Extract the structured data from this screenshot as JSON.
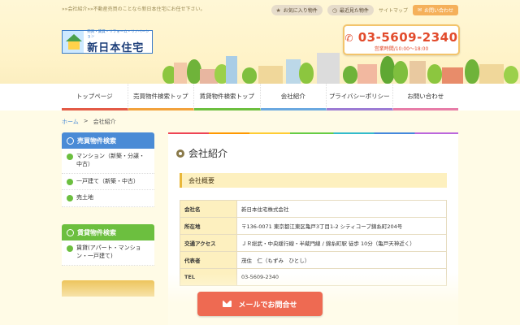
{
  "header": {
    "tagline": "»»会社紹介»»不動産売買のことなら新日本住宅にお任せ下さい。",
    "favorites_label": "お気に入り物件",
    "recent_label": "最近見た物件",
    "sitemap_label": "サイトマップ",
    "contact_label": "お問い合わせ",
    "logo_sub": "売買・賃貸・リフォーム・リノベーション",
    "logo_name": "新日本住宅",
    "phone": "03-5609-2340",
    "hours": "営業時間/10:00～18:00"
  },
  "nav": [
    {
      "label": "トップページ",
      "color": "#e35a46"
    },
    {
      "label": "売買物件検索トップ",
      "color": "#f2a23c"
    },
    {
      "label": "賃貸物件検索トップ",
      "color": "#6cbf3f"
    },
    {
      "label": "会社紹介",
      "color": "#6aa8e0"
    },
    {
      "label": "プライバシーポリシー",
      "color": "#9c7bd4"
    },
    {
      "label": "お問い合わせ",
      "color": "#e77ca8"
    }
  ],
  "breadcrumb": {
    "home": "ホーム",
    "sep": ">",
    "current": "会社紹介"
  },
  "sidebar": {
    "buy_heading": "売買物件検索",
    "buy_items": [
      "マンション（新築・分譲・中古）",
      "一戸建て（新築・中古）",
      "売土地"
    ],
    "rent_heading": "賃貸物件検索",
    "rent_items": [
      "賃貸(アパート・マンション・一戸建て)"
    ]
  },
  "main": {
    "title": "会社紹介",
    "section": "会社概要",
    "rows": [
      {
        "key": "会社名",
        "value": "新日本住宅株式会社"
      },
      {
        "key": "所在地",
        "value": "〒136-0071 東京都江東区亀戸3丁目1-2 シティコープ錦糸町204号"
      },
      {
        "key": "交通アクセス",
        "value": "ＪＲ総武・中央緩行線・半蔵門線 / 錦糸町駅 徒歩 10分（亀戸天神近く）"
      },
      {
        "key": "代表者",
        "value": "茂住　仁（もずみ　ひとし）"
      },
      {
        "key": "TEL",
        "value": "03-5609-2340"
      }
    ]
  },
  "footer": {
    "mail_button": "メールでお問合せ"
  },
  "colors": {
    "accent": "#ee6a52",
    "sidebar_buy": "#4a8bd6",
    "sidebar_rent": "#6cbf3f",
    "phone": "#e24b2c"
  }
}
